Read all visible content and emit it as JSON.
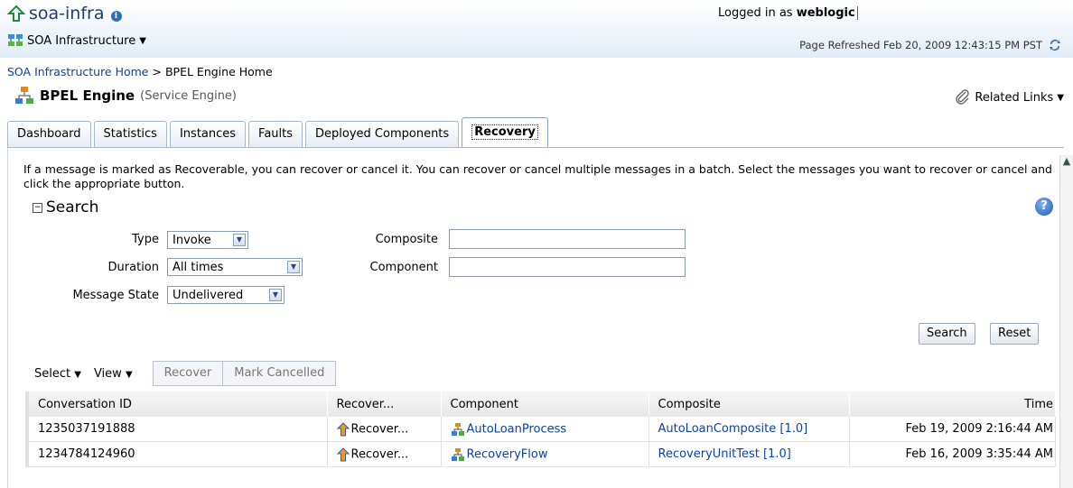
{
  "header": {
    "app_title": "soa-infra",
    "app_menu": "SOA Infrastructure",
    "logged_prefix": "Logged in as",
    "user": "weblogic",
    "refreshed": "Page Refreshed Feb 20, 2009 12:43:15 PM PST"
  },
  "breadcrumb": {
    "home": "SOA Infrastructure Home",
    "separator": ">",
    "current": "BPEL Engine Home"
  },
  "page": {
    "title": "BPEL Engine",
    "subtitle": "(Service Engine)",
    "related_links": "Related Links"
  },
  "tabs": [
    "Dashboard",
    "Statistics",
    "Instances",
    "Faults",
    "Deployed Components",
    "Recovery"
  ],
  "description": "If a message is marked as Recoverable, you can recover or cancel it. You can recover or cancel multiple messages in a batch. Select the messages you want to recover or cancel and click the appropriate button.",
  "search": {
    "heading": "Search",
    "type_label": "Type",
    "type_value": "Invoke",
    "duration_label": "Duration",
    "duration_value": "All times",
    "state_label": "Message State",
    "state_value": "Undelivered",
    "composite_label": "Composite",
    "component_label": "Component",
    "search_button": "Search",
    "reset_button": "Reset"
  },
  "toolbar": {
    "select": "Select",
    "view": "View",
    "recover": "Recover",
    "mark_cancelled": "Mark Cancelled"
  },
  "table": {
    "columns": [
      "Conversation ID",
      "Recover...",
      "Component",
      "Composite",
      "Time"
    ],
    "rows": [
      {
        "id": "1235037191888",
        "recover": "Recover...",
        "component": "AutoLoanProcess",
        "composite": "AutoLoanComposite [1.0]",
        "time": "Feb 19, 2009 2:16:44 AM"
      },
      {
        "id": "1234784124960",
        "recover": "Recover...",
        "component": "RecoveryFlow",
        "composite": "RecoveryUnitTest [1.0]",
        "time": "Feb 16, 2009 3:35:44 AM"
      }
    ]
  },
  "colors": {
    "link": "#0b43a4",
    "header_bg": "#e2ecf7",
    "tab_border": "#a7b7cc"
  },
  "icons": [
    "up-arrow-icon",
    "info-icon",
    "soa-infra-icon",
    "refresh-icon",
    "bpel-engine-icon",
    "paperclip-icon",
    "help-icon",
    "recover-icon",
    "component-icon"
  ]
}
